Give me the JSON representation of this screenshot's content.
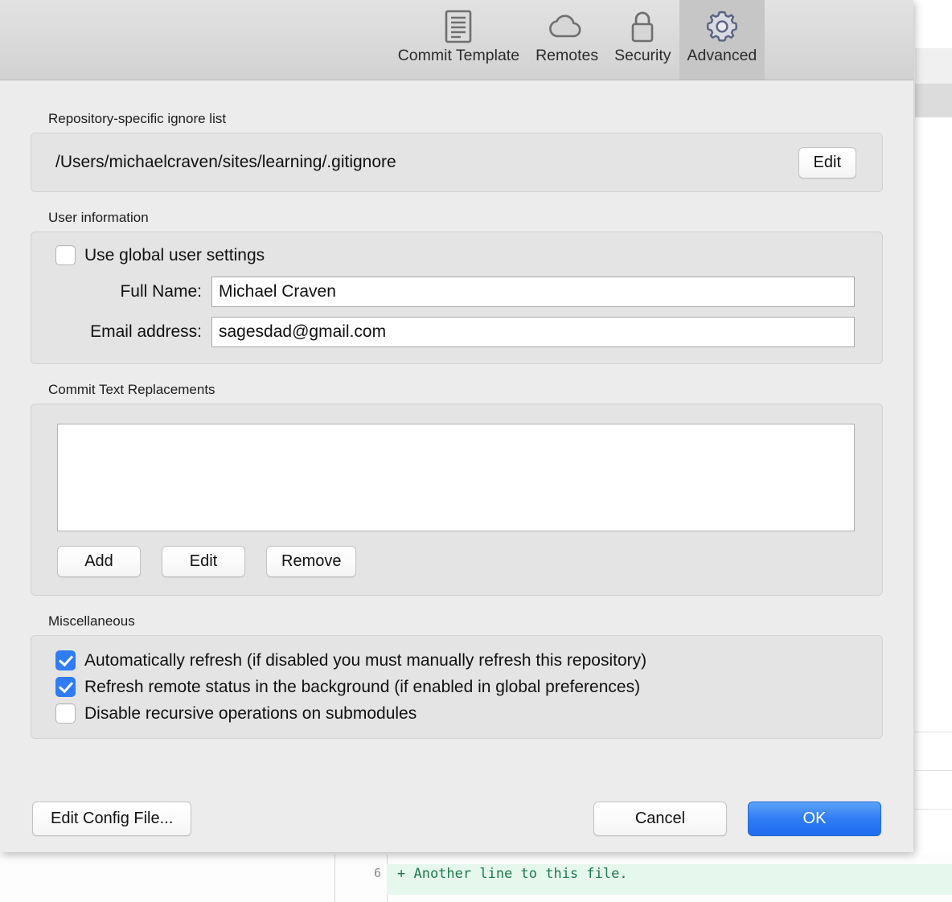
{
  "toolbar": {
    "tabs": [
      {
        "label": "Commit Template",
        "icon": "document-icon",
        "selected": false
      },
      {
        "label": "Remotes",
        "icon": "cloud-icon",
        "selected": false
      },
      {
        "label": "Security",
        "icon": "lock-icon",
        "selected": false
      },
      {
        "label": "Advanced",
        "icon": "gear-icon",
        "selected": true
      }
    ]
  },
  "ignore_list": {
    "group_label": "Repository-specific ignore list",
    "path": "/Users/michaelcraven/sites/learning/.gitignore",
    "edit_label": "Edit"
  },
  "user_information": {
    "group_label": "User information",
    "use_global_label": "Use global user settings",
    "use_global_checked": false,
    "full_name_label": "Full Name:",
    "full_name_value": "Michael Craven",
    "email_label": "Email address:",
    "email_value": "sagesdad@gmail.com"
  },
  "commit_text_replacements": {
    "group_label": "Commit Text Replacements",
    "items": [],
    "add_label": "Add",
    "edit_label": "Edit",
    "remove_label": "Remove"
  },
  "miscellaneous": {
    "group_label": "Miscellaneous",
    "options": [
      {
        "label": "Automatically refresh (if disabled you must manually refresh this repository)",
        "checked": true
      },
      {
        "label": "Refresh remote status in the background (if enabled in global preferences)",
        "checked": true
      },
      {
        "label": "Disable recursive operations on submodules",
        "checked": false
      }
    ]
  },
  "footer": {
    "edit_config_label": "Edit Config File...",
    "cancel_label": "Cancel",
    "ok_label": "OK"
  },
  "background": {
    "diff_line_number": "6",
    "diff_line_text": "+ Another line to this file."
  },
  "colors": {
    "accent": "#2f7cf6",
    "checkbox_checked": "#2f7cf6",
    "gear_icon": "#5a6480",
    "diff_added_text": "#1f7a4d",
    "diff_added_bg": "#e6f7ee",
    "toolbar_selected_bg": "#c6c6c6"
  }
}
